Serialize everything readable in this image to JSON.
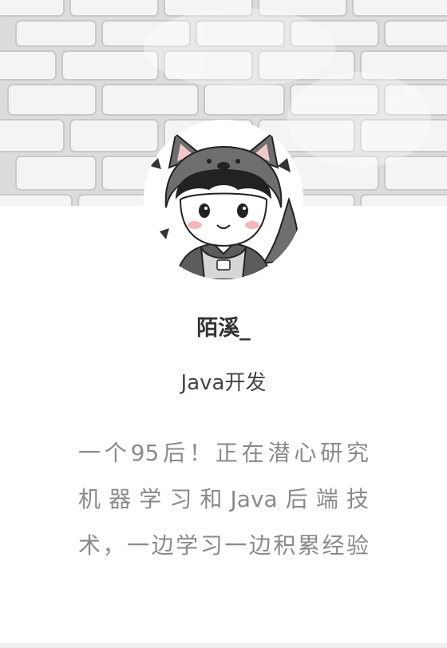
{
  "profile": {
    "name": "陌溪_",
    "role": "Java开发",
    "bio_lines": [
      "一个95后！正在潜心研究",
      "机器学习和Java后端技",
      "术，一边学习一边积累经验"
    ]
  },
  "cover": {
    "image": "white-brick-wall"
  },
  "avatar": {
    "image": "cartoon-boy-in-wolf-hood-icon"
  },
  "colors": {
    "name_text": "#333333",
    "role_text": "#444444",
    "bio_text": "#8a8a8a",
    "background": "#ffffff"
  }
}
